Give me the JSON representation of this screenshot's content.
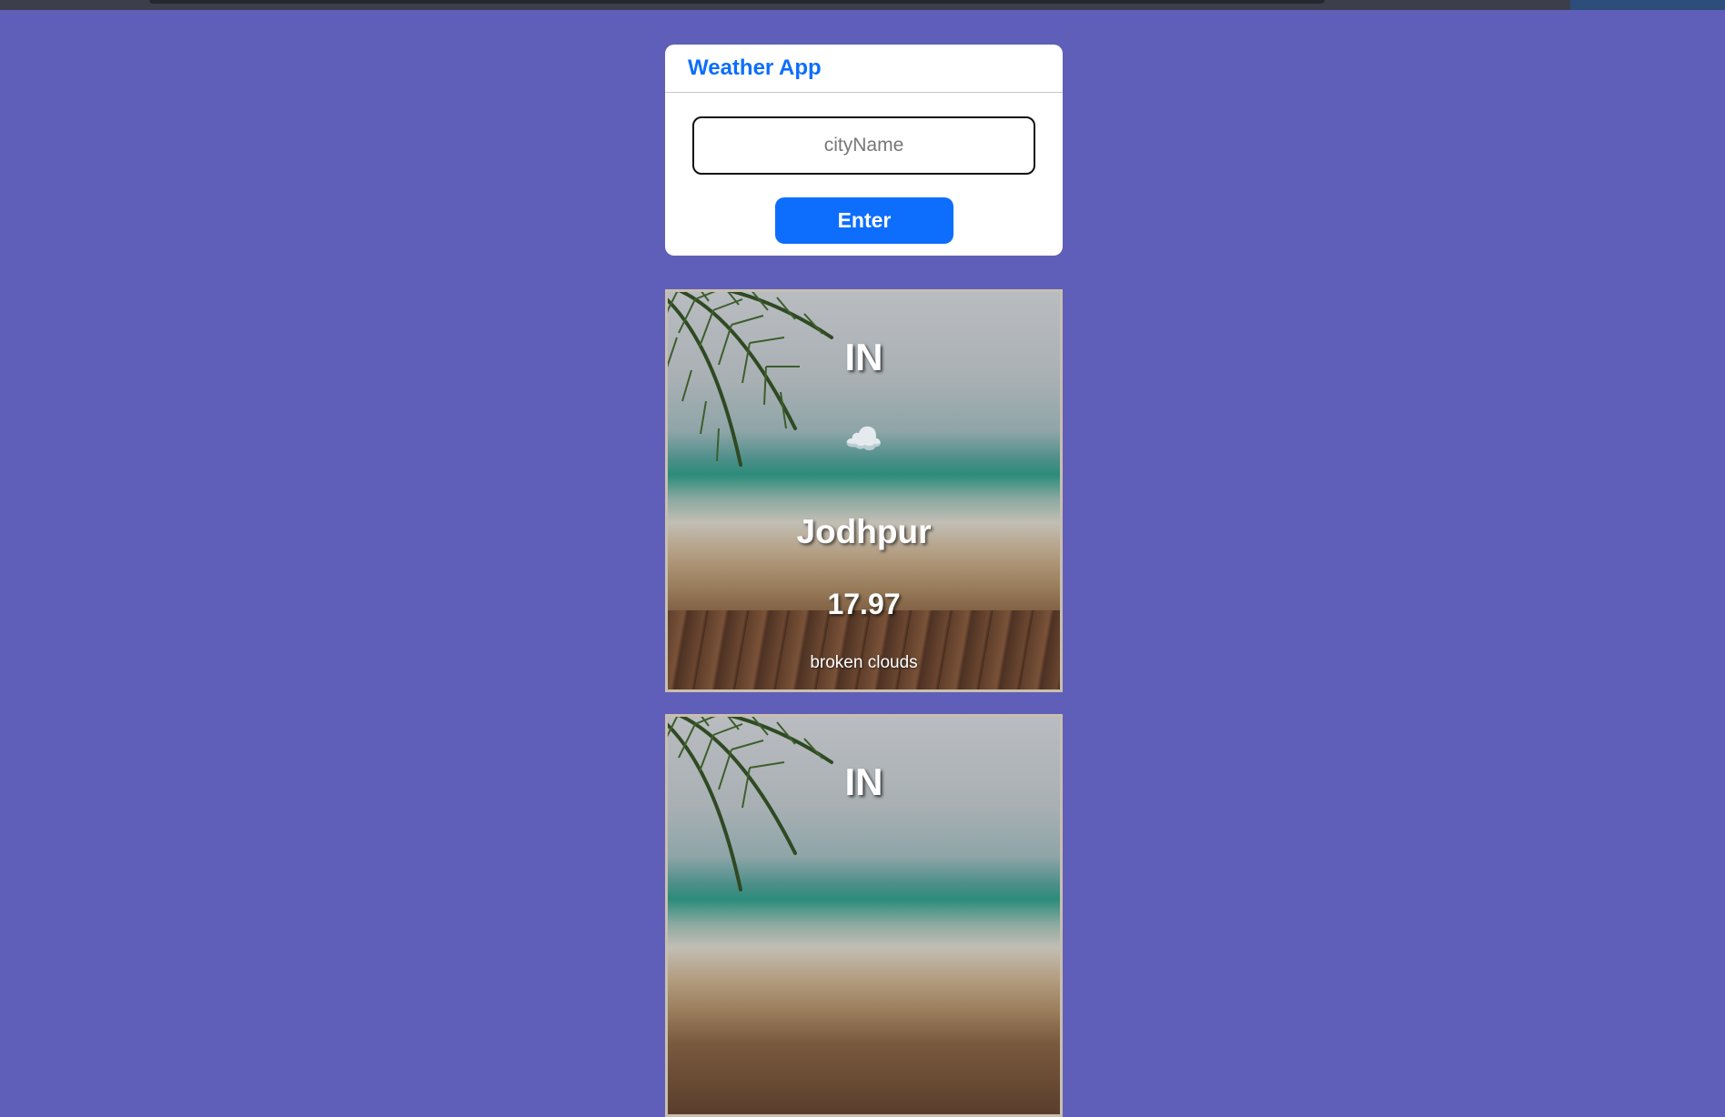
{
  "app": {
    "title": "Weather App"
  },
  "search": {
    "placeholder": "cityName",
    "value": "",
    "button_label": "Enter"
  },
  "results": [
    {
      "country": "IN",
      "icon": "broken-clouds-icon",
      "icon_glyph": "☁️",
      "city": "Jodhpur",
      "temperature": "17.97",
      "description": "broken clouds"
    },
    {
      "country": "IN"
    }
  ],
  "colors": {
    "page_background": "#5f5fb9",
    "accent": "#0d6efd",
    "card_background": "#ffffff"
  }
}
